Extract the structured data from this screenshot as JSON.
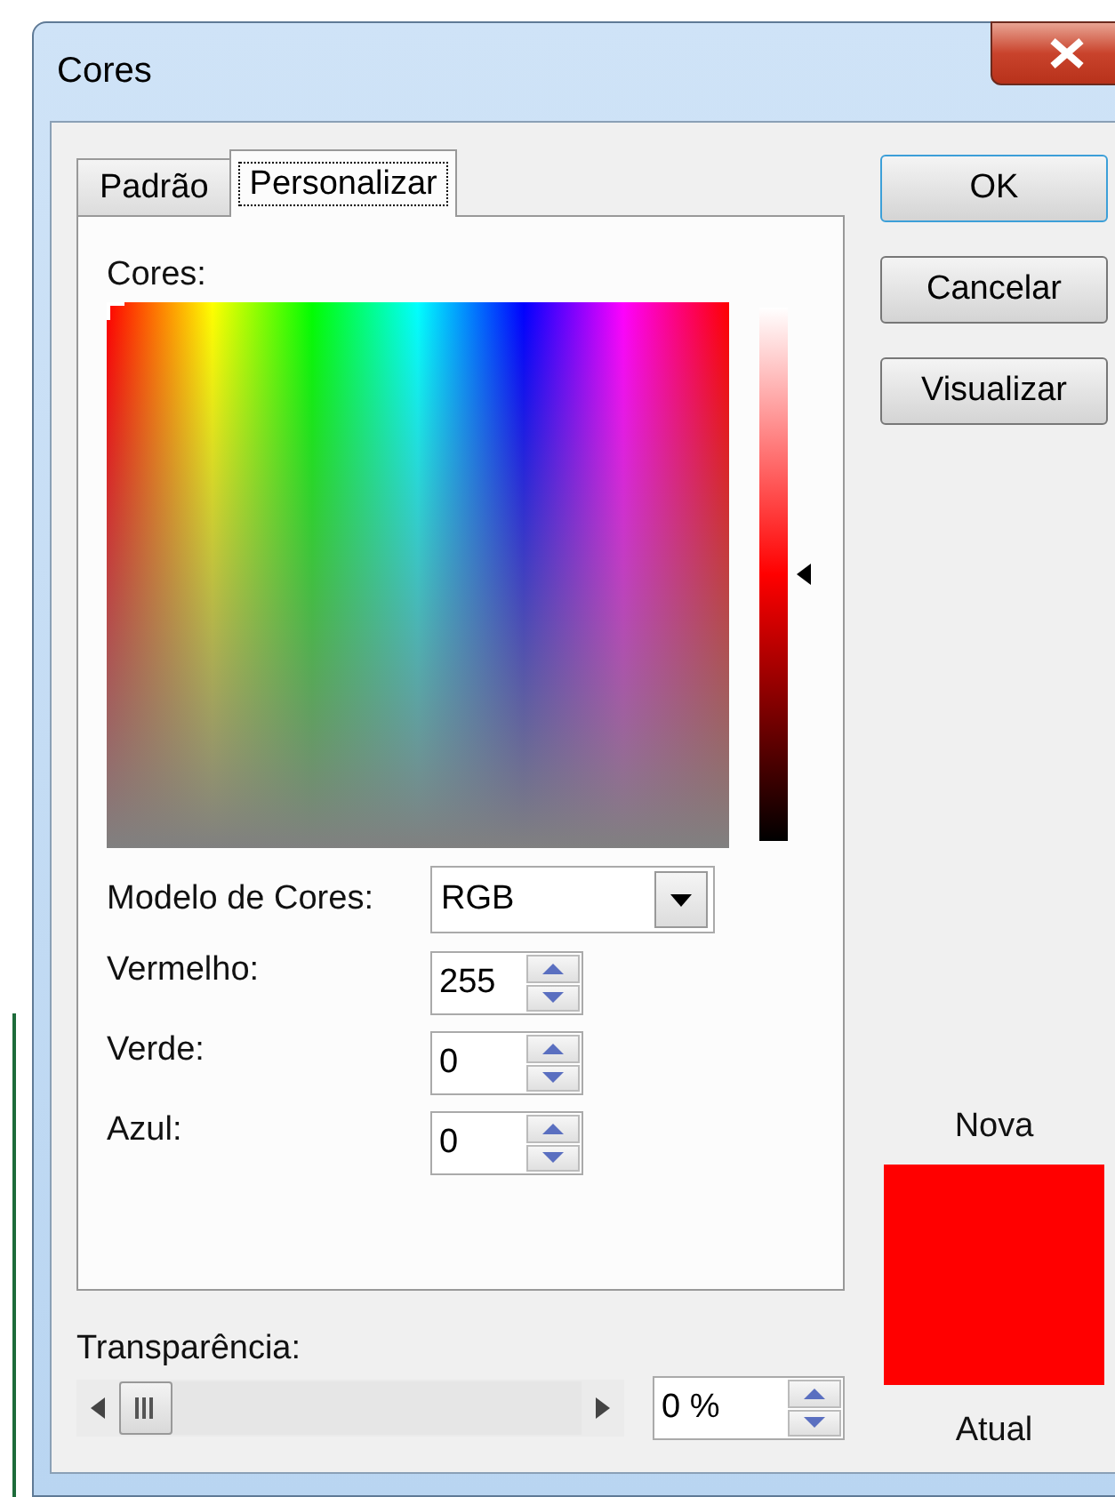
{
  "window": {
    "title": "Cores"
  },
  "tabs": [
    {
      "label": "Padrão",
      "selected": false
    },
    {
      "label": "Personalizar",
      "selected": true
    }
  ],
  "colors_label": "Cores:",
  "luminance": {
    "level": 0.5
  },
  "color_model": {
    "label": "Modelo de Cores:",
    "value": "RGB"
  },
  "channels": [
    {
      "label": "Vermelho:",
      "value": "255"
    },
    {
      "label": "Verde:",
      "value": "0"
    },
    {
      "label": "Azul:",
      "value": "0"
    }
  ],
  "transparency": {
    "label": "Transparência:",
    "level": 0,
    "value": "0 %"
  },
  "buttons": [
    {
      "label": "OK",
      "default": true
    },
    {
      "label": "Cancelar",
      "default": false
    },
    {
      "label": "Visualizar",
      "default": false
    }
  ],
  "preview": {
    "new_label": "Nova",
    "color": "#ff0000",
    "current_label": "Atual"
  }
}
